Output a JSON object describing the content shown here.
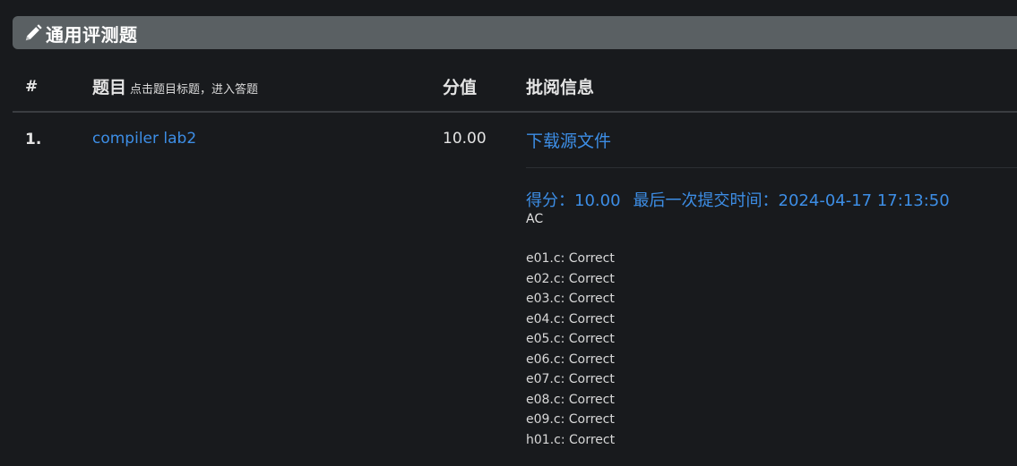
{
  "panel": {
    "title": "通用评测题"
  },
  "table": {
    "headers": {
      "index": "#",
      "topic": "题目",
      "topic_hint": "点击题目标题，进入答题",
      "score": "分值",
      "review": "批阅信息"
    },
    "rows": [
      {
        "index": "1.",
        "title": "compiler lab2",
        "score": "10.00",
        "download_label": "下载源文件",
        "score_text": "得分：10.00",
        "submit_time_text": "最后一次提交时间：2024-04-17 17:13:50",
        "verdict": "AC",
        "results": [
          "e01.c: Correct",
          "e02.c: Correct",
          "e03.c: Correct",
          "e04.c: Correct",
          "e05.c: Correct",
          "e06.c: Correct",
          "e07.c: Correct",
          "e08.c: Correct",
          "e09.c: Correct",
          "h01.c: Correct"
        ]
      }
    ]
  },
  "icons": {
    "panel_icon": "pencil-icon"
  },
  "colors": {
    "background": "#181a1d",
    "header_bar": "#5a6063",
    "link": "#3d8ee6"
  }
}
